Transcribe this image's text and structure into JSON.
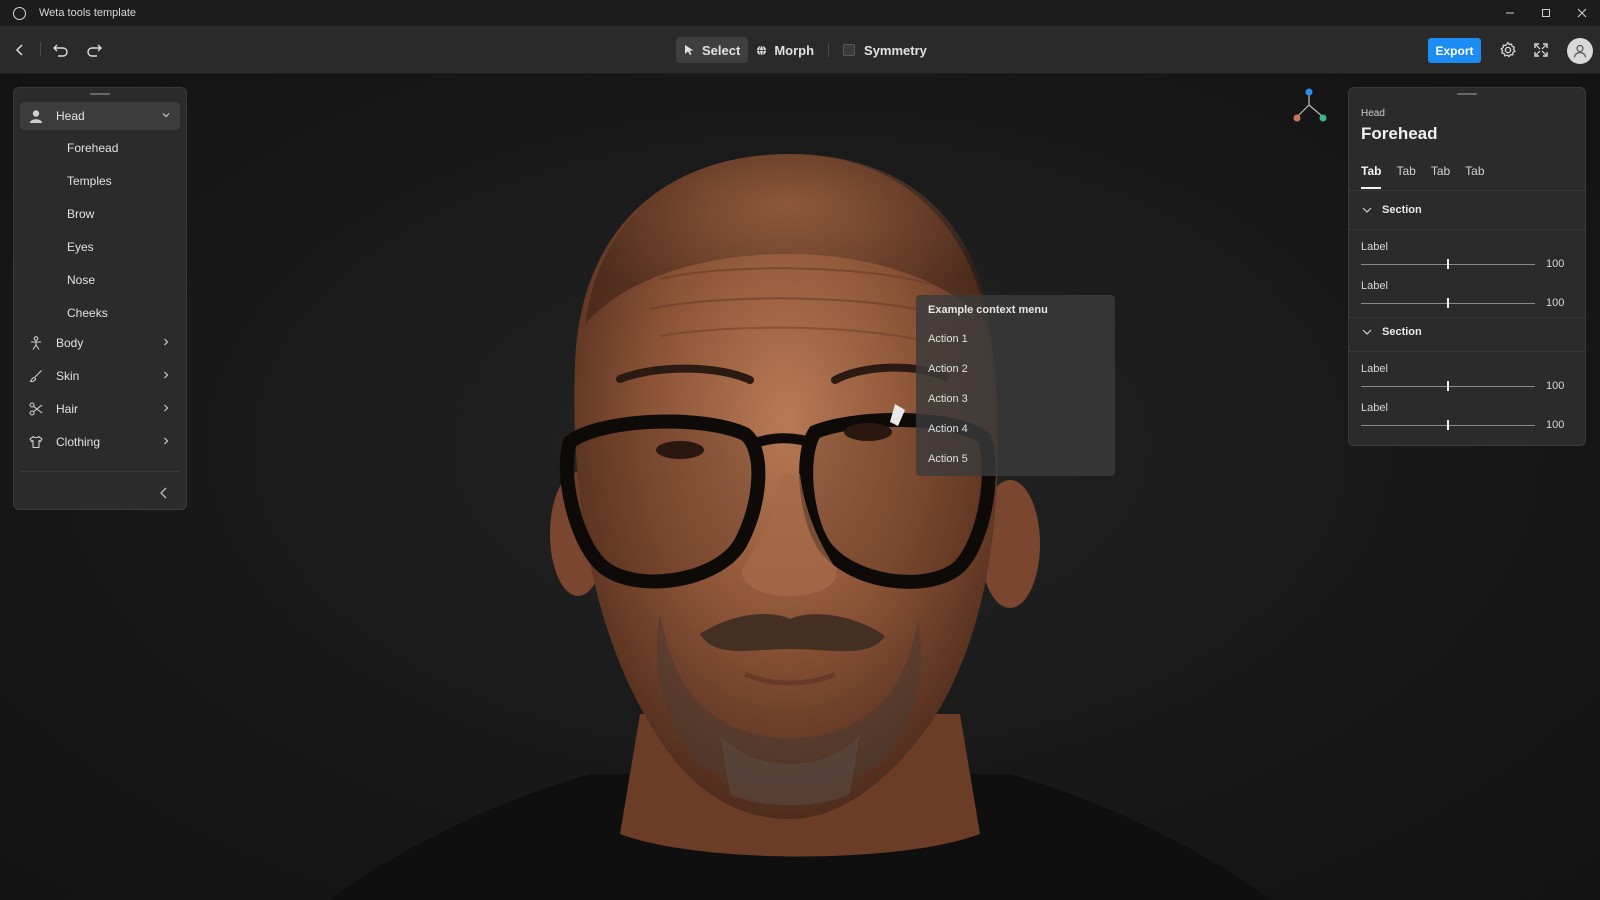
{
  "window": {
    "title": "Weta tools template",
    "controls": [
      "minimize",
      "maximize",
      "close"
    ]
  },
  "toolbar": {
    "modes": [
      {
        "label": "Select",
        "icon": "cursor-arrow-icon",
        "active": true
      },
      {
        "label": "Morph",
        "icon": "globe-icon",
        "active": false
      },
      {
        "label": "Symmetry",
        "icon": "checkbox-icon",
        "active": false,
        "checked": false
      }
    ],
    "export_label": "Export"
  },
  "left_panel": {
    "head": {
      "label": "Head",
      "icon": "person-icon",
      "expanded": true
    },
    "head_items": [
      "Forehead",
      "Temples",
      "Brow",
      "Eyes",
      "Nose",
      "Cheeks"
    ],
    "categories": [
      {
        "label": "Body",
        "icon": "body-icon"
      },
      {
        "label": "Skin",
        "icon": "brush-icon"
      },
      {
        "label": "Hair",
        "icon": "scissors-icon"
      },
      {
        "label": "Clothing",
        "icon": "shirt-icon"
      }
    ]
  },
  "gizmo_colors": {
    "y": "#2b8fe8",
    "x": "#c9775a",
    "z": "#3fb48a"
  },
  "context_menu": {
    "title": "Example context menu",
    "items": [
      "Action 1",
      "Action 2",
      "Action 3",
      "Action 4",
      "Action 5"
    ]
  },
  "right_panel": {
    "breadcrumb": "Head",
    "title": "Forehead",
    "tabs": [
      "Tab",
      "Tab",
      "Tab",
      "Tab"
    ],
    "sections": [
      {
        "label": "Section",
        "sliders": [
          {
            "label": "Label",
            "value": "100",
            "fraction": 0.5
          },
          {
            "label": "Label",
            "value": "100",
            "fraction": 0.5
          }
        ]
      },
      {
        "label": "Section",
        "sliders": [
          {
            "label": "Label",
            "value": "100",
            "fraction": 0.5
          },
          {
            "label": "Label",
            "value": "100",
            "fraction": 0.5
          }
        ]
      }
    ]
  },
  "accent_color": "#1a8cf2"
}
